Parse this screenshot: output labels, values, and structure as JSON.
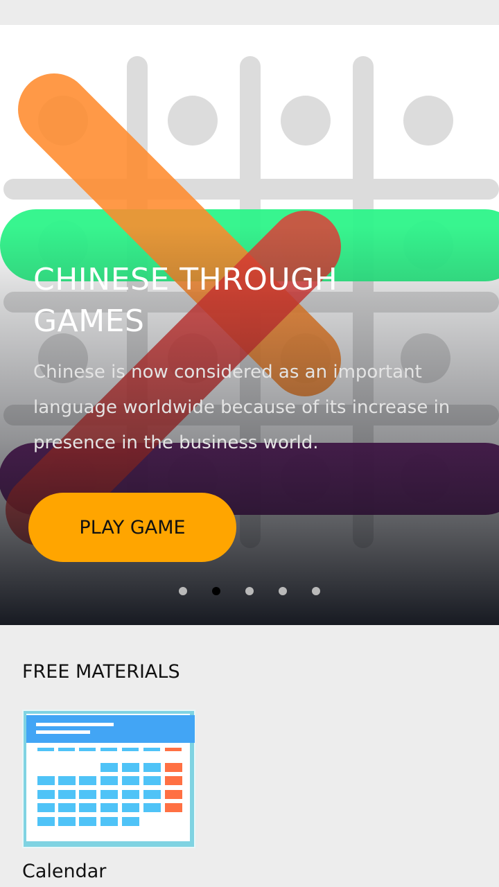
{
  "hero": {
    "title": "CHINESE THROUGH GAMES",
    "description": "Chinese is now considered as an important language worldwide because of its increase in presence in the business world.",
    "button_label": "PLAY GAME",
    "image_icon": "tic-tac-toe-strike-illustration",
    "colors": {
      "button": "#ffa500",
      "strike_orange": "#ff8c2e",
      "strike_red": "#e53935",
      "strike_green": "#2ef58a",
      "strike_purple": "#6a1f6e"
    }
  },
  "carousel": {
    "slide_count": 5,
    "active_index": 1
  },
  "materials": {
    "section_title": "FREE MATERIALS",
    "items": [
      {
        "label": "Calendar",
        "icon": "calendar-icon"
      }
    ]
  }
}
